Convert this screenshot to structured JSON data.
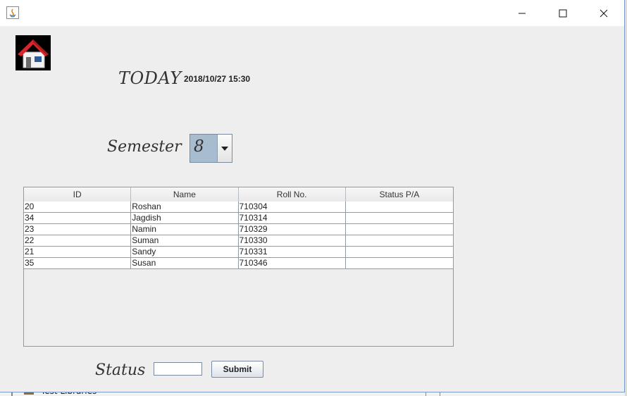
{
  "window": {
    "controls": {
      "minimize": "minimize-icon",
      "maximize": "maximize-icon",
      "close": "close-icon"
    }
  },
  "header": {
    "home_icon": "home-icon",
    "today_label": "TODAY",
    "datetime": "2018/10/27 15:30"
  },
  "semester": {
    "label": "Semester",
    "selected": "8"
  },
  "table": {
    "columns": [
      "ID",
      "Name",
      "Roll No.",
      "Status P/A"
    ],
    "rows": [
      [
        "20",
        "Roshan",
        "710304",
        ""
      ],
      [
        "34",
        "Jagdish",
        "710314",
        ""
      ],
      [
        "23",
        "Namin",
        "710329",
        ""
      ],
      [
        "22",
        "Suman",
        "710330",
        ""
      ],
      [
        "21",
        "Sandy",
        "710331",
        ""
      ],
      [
        "35",
        "Susan",
        "710346",
        ""
      ]
    ]
  },
  "status": {
    "label": "Status",
    "value": "",
    "submit_label": "Submit"
  },
  "background": {
    "partial_text": "Test Libraries"
  },
  "colors": {
    "window_bg": "#eeeeee",
    "combo_bg": "#a8bcd0",
    "house_roof": "#d9262b"
  }
}
